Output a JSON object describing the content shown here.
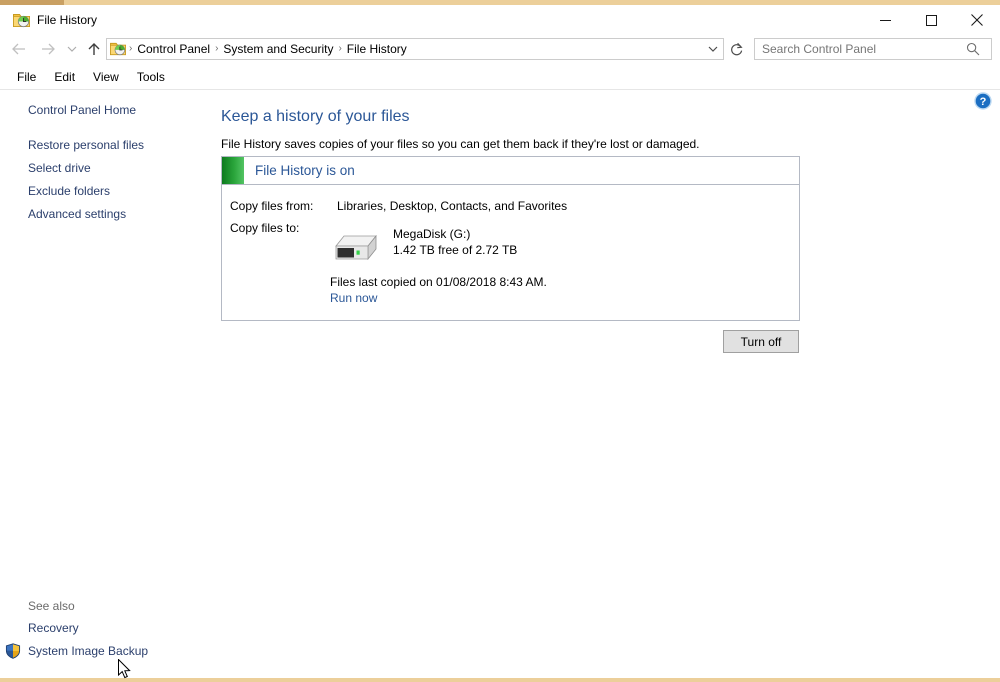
{
  "window": {
    "title": "File History",
    "title_icon": "file-history-icon",
    "controls": {
      "minimize": "minimize-icon",
      "maximize": "maximize-icon",
      "close": "close-icon"
    }
  },
  "addressbar": {
    "back": "back-arrow-icon",
    "forward": "forward-arrow-icon",
    "recent": "recent-locations-chevron-icon",
    "up": "up-arrow-icon",
    "path_icon": "file-history-icon",
    "breadcrumb": [
      "Control Panel",
      "System and Security",
      "File History"
    ],
    "separator": "›",
    "dropdown": "chevron-down-icon",
    "refresh": "refresh-icon",
    "search": {
      "placeholder": "Search Control Panel",
      "value": "",
      "icon": "search-icon"
    }
  },
  "menubar": {
    "items": [
      "File",
      "Edit",
      "View",
      "Tools"
    ]
  },
  "help": {
    "icon": "help-question-icon",
    "label": "Help"
  },
  "sidebar": {
    "home": "Control Panel Home",
    "items": [
      "Restore personal files",
      "Select drive",
      "Exclude folders",
      "Advanced settings"
    ],
    "see_also": {
      "label": "See also",
      "items": [
        "Recovery",
        "System Image Backup"
      ],
      "shield_icon": "uac-shield-icon"
    }
  },
  "main": {
    "title": "Keep a history of your files",
    "subtitle": "File History saves copies of your files so you can get them back if they're lost or damaged.",
    "status_panel": {
      "status_color": "#2aa53b",
      "status_text": "File History is on",
      "copy_from_label": "Copy files from:",
      "copy_from_value": "Libraries, Desktop, Contacts, and Favorites",
      "copy_to_label": "Copy files to:",
      "drive_icon": "external-hard-drive-icon",
      "drive_name": "MegaDisk (G:)",
      "drive_space": "1.42 TB free of 2.72 TB",
      "last_copied": "Files last copied on 01/08/2018 8:43 AM.",
      "run_now": "Run now"
    },
    "turn_off_button": "Turn off"
  },
  "colors": {
    "accent_blue": "#2b5797",
    "link_blue": "#2b3f6c",
    "status_green": "#2aa53b",
    "window_border": "#eccf9a"
  },
  "cursor": {
    "icon": "mouse-pointer-icon"
  }
}
